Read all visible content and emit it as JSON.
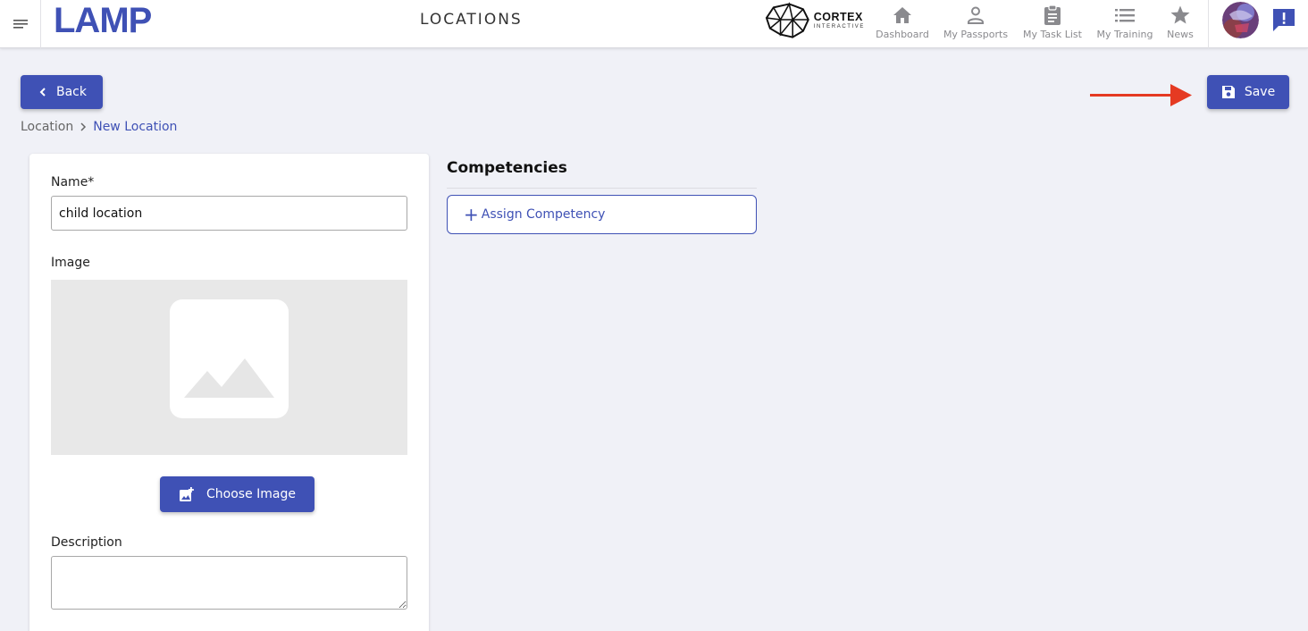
{
  "header": {
    "logo_text": "LAMP",
    "page_title": "LOCATIONS",
    "partner_logo": {
      "name": "CORTEX",
      "subtitle": "INTERACTIVE"
    },
    "nav": [
      {
        "label": "Dashboard",
        "icon": "home-icon"
      },
      {
        "label": "My Passports",
        "icon": "person-icon"
      },
      {
        "label": "My Task List",
        "icon": "clipboard-icon"
      },
      {
        "label": "My Training",
        "icon": "list-icon"
      },
      {
        "label": "News",
        "icon": "star-icon"
      }
    ],
    "colors": {
      "nav_icon": "#8a8a8e",
      "brand": "#3f51b5"
    }
  },
  "toolbar": {
    "back_label": "Back",
    "save_label": "Save",
    "annotation_arrow_color": "#e53a22"
  },
  "breadcrumb": {
    "root": "Location",
    "current": "New Location"
  },
  "form": {
    "name_label": "Name*",
    "name_value": "child location",
    "image_label": "Image",
    "choose_image_label": "Choose Image",
    "description_label": "Description",
    "description_value": ""
  },
  "competencies": {
    "title": "Competencies",
    "assign_label": "Assign Competency",
    "assign_icon": "+"
  }
}
